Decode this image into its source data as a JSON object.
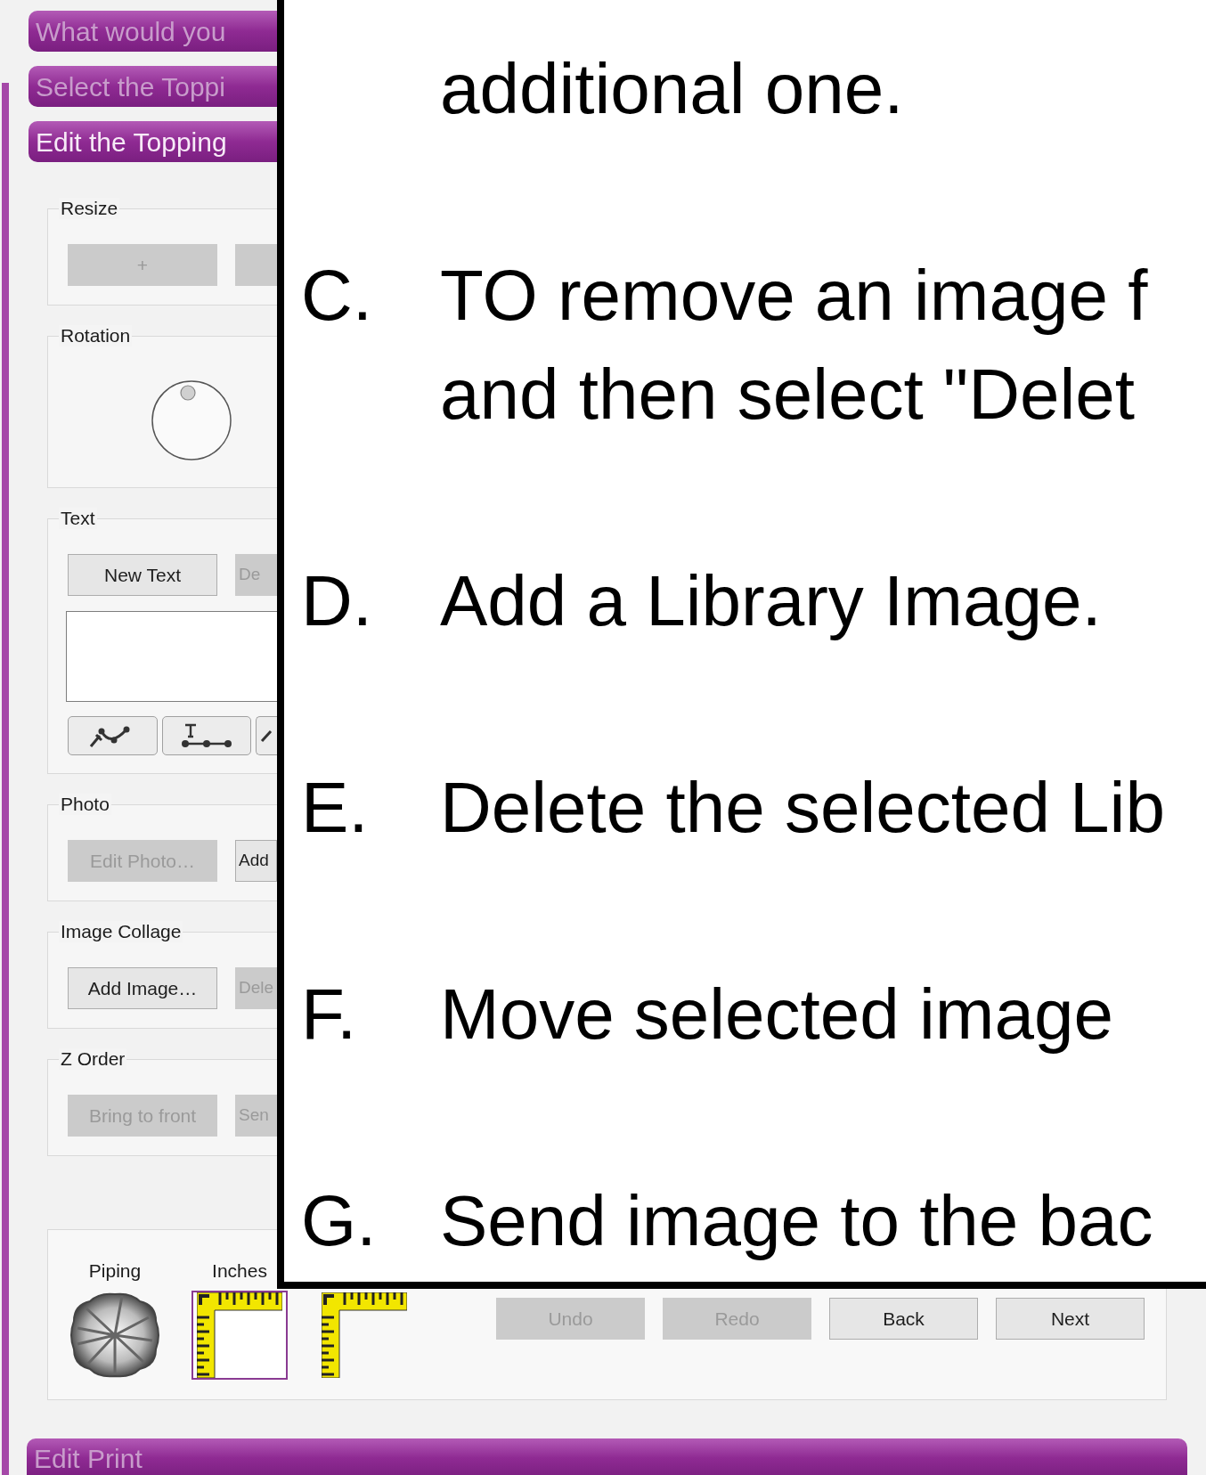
{
  "steps": [
    {
      "label": "What would you",
      "active": false
    },
    {
      "label": "Select the Toppi",
      "active": false
    },
    {
      "label": "Edit the Topping",
      "active": true
    }
  ],
  "groups": [
    {
      "title": "Resize",
      "kind": "buttons",
      "buttons": [
        {
          "label": "+",
          "disabled": true
        },
        {
          "disabled": true
        }
      ]
    },
    {
      "title": "Rotation",
      "kind": "dial"
    },
    {
      "title": "Text",
      "kind": "text",
      "buttons": [
        {
          "label": "New Text",
          "disabled": false
        },
        {
          "label": "De",
          "disabled": true
        }
      ]
    },
    {
      "title": "Photo",
      "kind": "buttons",
      "buttons": [
        {
          "label": "Edit Photo…",
          "disabled": true
        },
        {
          "label": "Add",
          "disabled": false
        }
      ]
    },
    {
      "title": "Image Collage",
      "kind": "buttons",
      "buttons": [
        {
          "label": "Add Image…",
          "disabled": false
        },
        {
          "label": "Dele",
          "disabled": true
        }
      ]
    },
    {
      "title": "Z Order",
      "kind": "buttons",
      "buttons": [
        {
          "label": "Bring to front",
          "disabled": true
        },
        {
          "label": "Sen",
          "disabled": true
        }
      ]
    }
  ],
  "bottom": {
    "thumbnails": [
      {
        "label": "Piping",
        "kind": "shell",
        "selected": false
      },
      {
        "label": "Inches",
        "kind": "ruler",
        "selected": true
      },
      {
        "kind": "ruler",
        "selected": false
      }
    ],
    "buttons": [
      {
        "label": "Undo",
        "disabled": true
      },
      {
        "label": "Redo",
        "disabled": true
      },
      {
        "label": "Back",
        "disabled": false
      },
      {
        "label": "Next",
        "disabled": false
      }
    ]
  },
  "next_step": {
    "label": "Edit Print",
    "active": false
  },
  "instructions": [
    {
      "lines": [
        "additional one."
      ]
    },
    {
      "letter": "C.",
      "lines": [
        "TO remove an image f",
        "and then select \"Delet"
      ]
    },
    {
      "letter": "D.",
      "lines": [
        "Add a Library Image."
      ]
    },
    {
      "letter": "E.",
      "lines": [
        "Delete the selected Lib"
      ]
    },
    {
      "letter": "F.",
      "lines": [
        "Move selected image"
      ]
    },
    {
      "letter": "G.",
      "lines": [
        "Send image to the bac"
      ]
    }
  ]
}
